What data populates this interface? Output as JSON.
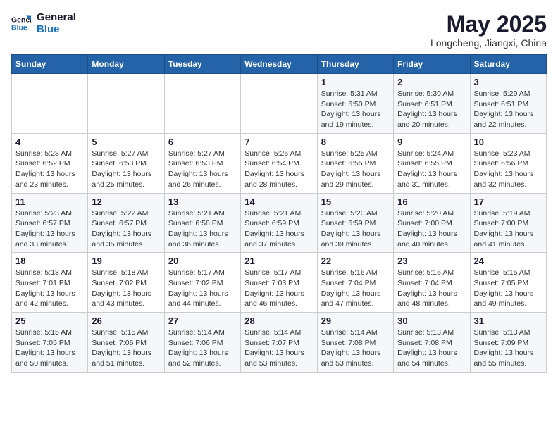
{
  "logo": {
    "line1": "General",
    "line2": "Blue"
  },
  "title": "May 2025",
  "subtitle": "Longcheng, Jiangxi, China",
  "days_of_week": [
    "Sunday",
    "Monday",
    "Tuesday",
    "Wednesday",
    "Thursday",
    "Friday",
    "Saturday"
  ],
  "weeks": [
    [
      {
        "day": "",
        "info": ""
      },
      {
        "day": "",
        "info": ""
      },
      {
        "day": "",
        "info": ""
      },
      {
        "day": "",
        "info": ""
      },
      {
        "day": "1",
        "info": "Sunrise: 5:31 AM\nSunset: 6:50 PM\nDaylight: 13 hours\nand 19 minutes."
      },
      {
        "day": "2",
        "info": "Sunrise: 5:30 AM\nSunset: 6:51 PM\nDaylight: 13 hours\nand 20 minutes."
      },
      {
        "day": "3",
        "info": "Sunrise: 5:29 AM\nSunset: 6:51 PM\nDaylight: 13 hours\nand 22 minutes."
      }
    ],
    [
      {
        "day": "4",
        "info": "Sunrise: 5:28 AM\nSunset: 6:52 PM\nDaylight: 13 hours\nand 23 minutes."
      },
      {
        "day": "5",
        "info": "Sunrise: 5:27 AM\nSunset: 6:53 PM\nDaylight: 13 hours\nand 25 minutes."
      },
      {
        "day": "6",
        "info": "Sunrise: 5:27 AM\nSunset: 6:53 PM\nDaylight: 13 hours\nand 26 minutes."
      },
      {
        "day": "7",
        "info": "Sunrise: 5:26 AM\nSunset: 6:54 PM\nDaylight: 13 hours\nand 28 minutes."
      },
      {
        "day": "8",
        "info": "Sunrise: 5:25 AM\nSunset: 6:55 PM\nDaylight: 13 hours\nand 29 minutes."
      },
      {
        "day": "9",
        "info": "Sunrise: 5:24 AM\nSunset: 6:55 PM\nDaylight: 13 hours\nand 31 minutes."
      },
      {
        "day": "10",
        "info": "Sunrise: 5:23 AM\nSunset: 6:56 PM\nDaylight: 13 hours\nand 32 minutes."
      }
    ],
    [
      {
        "day": "11",
        "info": "Sunrise: 5:23 AM\nSunset: 6:57 PM\nDaylight: 13 hours\nand 33 minutes."
      },
      {
        "day": "12",
        "info": "Sunrise: 5:22 AM\nSunset: 6:57 PM\nDaylight: 13 hours\nand 35 minutes."
      },
      {
        "day": "13",
        "info": "Sunrise: 5:21 AM\nSunset: 6:58 PM\nDaylight: 13 hours\nand 36 minutes."
      },
      {
        "day": "14",
        "info": "Sunrise: 5:21 AM\nSunset: 6:59 PM\nDaylight: 13 hours\nand 37 minutes."
      },
      {
        "day": "15",
        "info": "Sunrise: 5:20 AM\nSunset: 6:59 PM\nDaylight: 13 hours\nand 39 minutes."
      },
      {
        "day": "16",
        "info": "Sunrise: 5:20 AM\nSunset: 7:00 PM\nDaylight: 13 hours\nand 40 minutes."
      },
      {
        "day": "17",
        "info": "Sunrise: 5:19 AM\nSunset: 7:00 PM\nDaylight: 13 hours\nand 41 minutes."
      }
    ],
    [
      {
        "day": "18",
        "info": "Sunrise: 5:18 AM\nSunset: 7:01 PM\nDaylight: 13 hours\nand 42 minutes."
      },
      {
        "day": "19",
        "info": "Sunrise: 5:18 AM\nSunset: 7:02 PM\nDaylight: 13 hours\nand 43 minutes."
      },
      {
        "day": "20",
        "info": "Sunrise: 5:17 AM\nSunset: 7:02 PM\nDaylight: 13 hours\nand 44 minutes."
      },
      {
        "day": "21",
        "info": "Sunrise: 5:17 AM\nSunset: 7:03 PM\nDaylight: 13 hours\nand 46 minutes."
      },
      {
        "day": "22",
        "info": "Sunrise: 5:16 AM\nSunset: 7:04 PM\nDaylight: 13 hours\nand 47 minutes."
      },
      {
        "day": "23",
        "info": "Sunrise: 5:16 AM\nSunset: 7:04 PM\nDaylight: 13 hours\nand 48 minutes."
      },
      {
        "day": "24",
        "info": "Sunrise: 5:15 AM\nSunset: 7:05 PM\nDaylight: 13 hours\nand 49 minutes."
      }
    ],
    [
      {
        "day": "25",
        "info": "Sunrise: 5:15 AM\nSunset: 7:05 PM\nDaylight: 13 hours\nand 50 minutes."
      },
      {
        "day": "26",
        "info": "Sunrise: 5:15 AM\nSunset: 7:06 PM\nDaylight: 13 hours\nand 51 minutes."
      },
      {
        "day": "27",
        "info": "Sunrise: 5:14 AM\nSunset: 7:06 PM\nDaylight: 13 hours\nand 52 minutes."
      },
      {
        "day": "28",
        "info": "Sunrise: 5:14 AM\nSunset: 7:07 PM\nDaylight: 13 hours\nand 53 minutes."
      },
      {
        "day": "29",
        "info": "Sunrise: 5:14 AM\nSunset: 7:08 PM\nDaylight: 13 hours\nand 53 minutes."
      },
      {
        "day": "30",
        "info": "Sunrise: 5:13 AM\nSunset: 7:08 PM\nDaylight: 13 hours\nand 54 minutes."
      },
      {
        "day": "31",
        "info": "Sunrise: 5:13 AM\nSunset: 7:09 PM\nDaylight: 13 hours\nand 55 minutes."
      }
    ]
  ]
}
